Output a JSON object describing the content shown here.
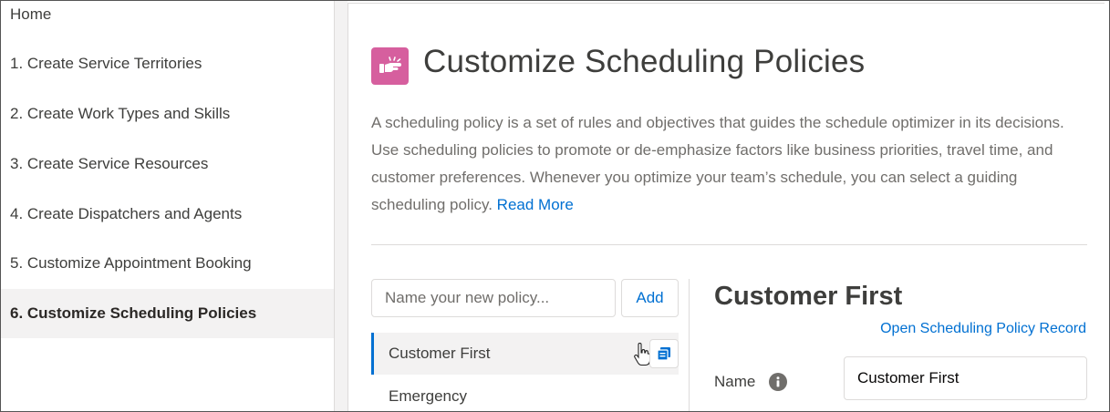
{
  "sidebar": {
    "items": [
      {
        "label": "Home"
      },
      {
        "label": "1. Create Service Territories"
      },
      {
        "label": "2. Create Work Types and Skills"
      },
      {
        "label": "3. Create Service Resources"
      },
      {
        "label": "4. Create Dispatchers and Agents"
      },
      {
        "label": "5. Customize Appointment Booking"
      },
      {
        "label": "6. Customize Scheduling Policies",
        "active": true
      }
    ]
  },
  "main": {
    "title": "Customize Scheduling Policies",
    "title_icon": "pointing-hand-icon",
    "accent_color": "#d65f9e",
    "description": "A scheduling policy is a set of rules and objectives that guides the schedule optimizer in its decisions. Use scheduling policies to promote or de-emphasize factors like business priorities, travel time, and customer preferences. Whenever you optimize your team’s schedule, you can select a guiding scheduling policy.",
    "read_more": "Read More",
    "link_color": "#0070d2"
  },
  "policies": {
    "new_policy_placeholder": "Name your new policy...",
    "new_policy_value": "",
    "add_label": "Add",
    "list": [
      {
        "label": "Customer First",
        "selected": true
      },
      {
        "label": "Emergency"
      }
    ],
    "clone_icon": "clone-icon"
  },
  "detail": {
    "title": "Customer First",
    "open_record_label": "Open Scheduling Policy Record",
    "name_label": "Name",
    "name_value": "Customer First",
    "info_icon": "info-icon"
  }
}
